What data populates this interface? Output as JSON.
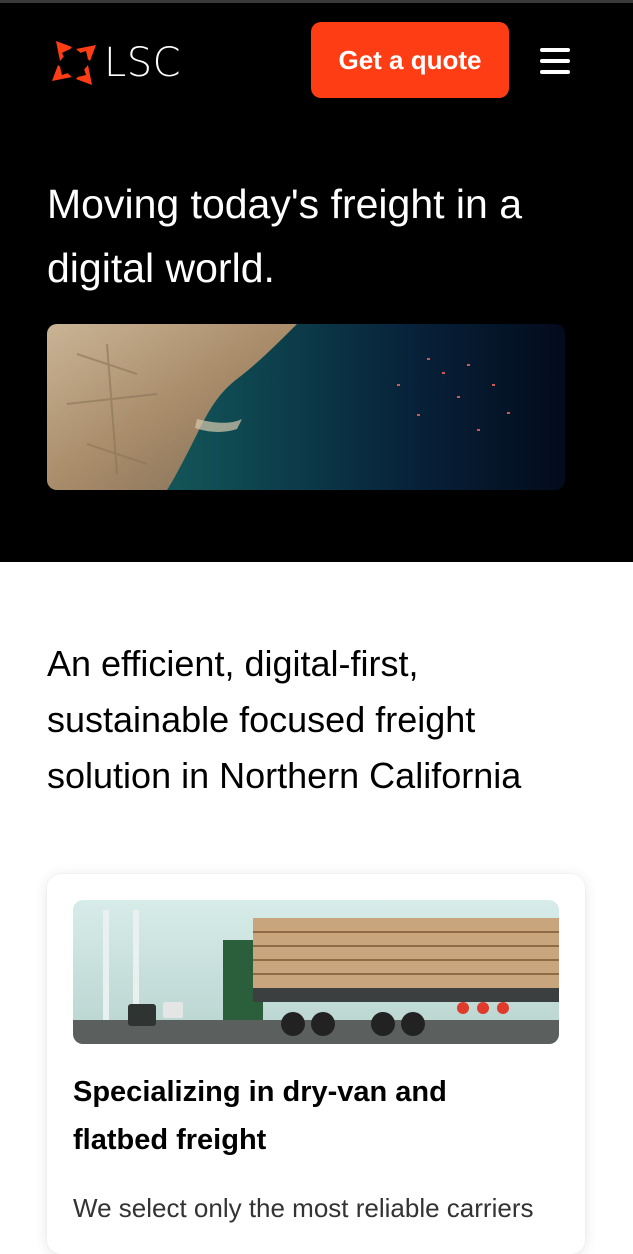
{
  "header": {
    "logo_text": "LSC",
    "cta_label": "Get a quote",
    "menu_icon": "hamburger-menu-icon"
  },
  "hero": {
    "title": "Moving today's freight in a digital world.",
    "image": "satellite-port-aerial-image"
  },
  "intro": {
    "text": "An efficient, digital-first, sustainable focused freight solution in Northern California"
  },
  "card": {
    "image": "lumber-truck-on-bridge-image",
    "title": "Specializing in dry-van and flatbed freight",
    "body": "We select only the most reliable carriers"
  },
  "colors": {
    "brand_accent": "#ff3d14",
    "hero_background": "#000000",
    "page_background": "#ffffff"
  }
}
